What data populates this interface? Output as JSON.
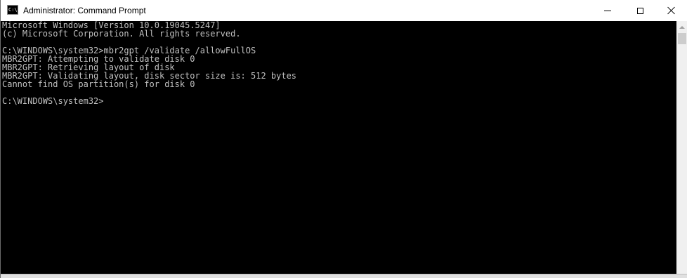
{
  "window": {
    "title": "Administrator: Command Prompt",
    "icon_label": "C:\\."
  },
  "controls": {
    "minimize": "minimize-icon",
    "maximize": "maximize-icon",
    "close": "close-icon"
  },
  "console": {
    "lines": [
      "Microsoft Windows [Version 10.0.19045.5247]",
      "(c) Microsoft Corporation. All rights reserved.",
      "",
      "C:\\WINDOWS\\system32>mbr2gpt /validate /allowFullOS",
      "MBR2GPT: Attempting to validate disk 0",
      "MBR2GPT: Retrieving layout of disk",
      "MBR2GPT: Validating layout, disk sector size is: 512 bytes",
      "Cannot find OS partition(s) for disk 0",
      "",
      "C:\\WINDOWS\\system32>"
    ]
  },
  "colors": {
    "console_bg": "#000000",
    "console_text": "#c0c0c0",
    "titlebar_bg": "#ffffff"
  }
}
